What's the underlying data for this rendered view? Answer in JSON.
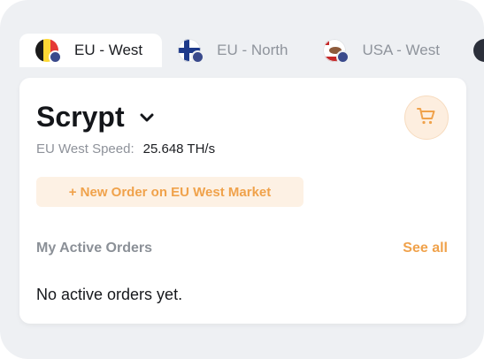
{
  "tabs": [
    {
      "label": "EU - West",
      "flag": "belgium-flag",
      "active": true
    },
    {
      "label": "EU - North",
      "flag": "finland-flag",
      "active": false
    },
    {
      "label": "USA - West",
      "flag": "california-flag",
      "active": false
    }
  ],
  "card": {
    "algorithm": "Scrypt",
    "speed_label": "EU West Speed:",
    "speed_value": "25.648 TH/s",
    "new_order_label": "+ New Order on EU West Market",
    "orders_title": "My Active Orders",
    "see_all_label": "See all",
    "empty_message": "No active orders yet."
  },
  "icons": {
    "dropdown": "chevron-down-icon",
    "cart": "cart-icon"
  },
  "colors": {
    "accent": "#f0a24b",
    "accent_bg": "#fdf1e4",
    "background": "#eef0f3",
    "card": "#ffffff"
  }
}
